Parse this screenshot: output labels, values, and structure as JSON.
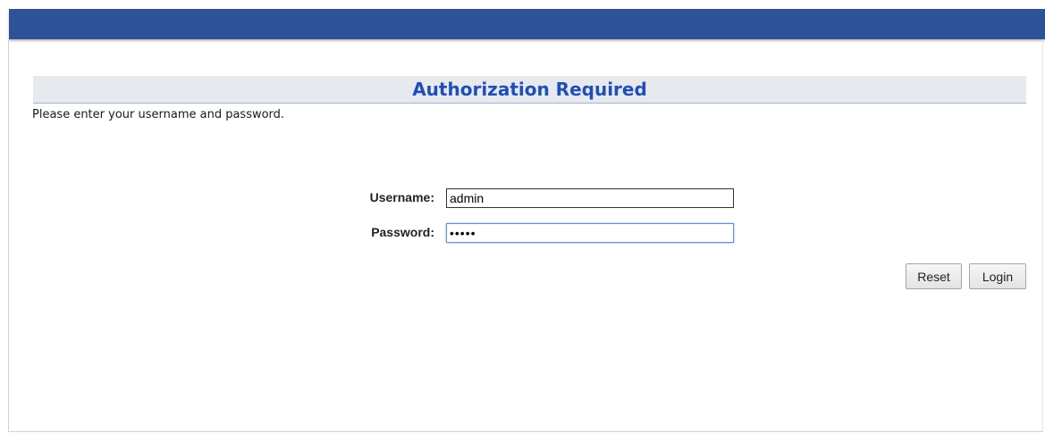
{
  "header": {
    "banner_color": "#2e5298"
  },
  "auth": {
    "title": "Authorization Required",
    "instructions": "Please enter your username and password.",
    "username_label": "Username:",
    "username_value": "admin",
    "password_label": "Password:",
    "password_value": "•••••"
  },
  "actions": {
    "reset_label": "Reset",
    "login_label": "Login"
  },
  "colors": {
    "title_text": "#1f4fb5",
    "title_bar_bg": "#e7e9ee"
  }
}
